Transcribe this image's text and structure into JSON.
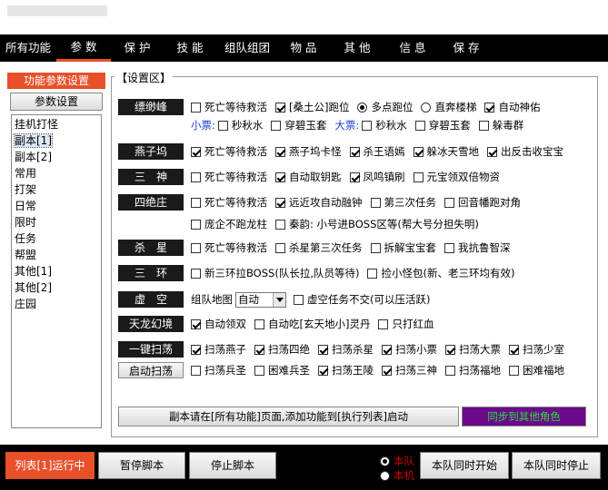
{
  "menu": {
    "tabs": [
      "所有功能",
      "参 数",
      "保 护",
      "技 能",
      "组队组团",
      "物 品",
      "其 他",
      "信 息",
      "保 存"
    ],
    "active_index": 1
  },
  "left": {
    "header": "功能参数设置",
    "param_button": "参数设置",
    "items": [
      "挂机打怪",
      "副本[1]",
      "副本[2]",
      "常用",
      "打架",
      "日常",
      "限时",
      "任务",
      "帮盟",
      "其他[1]",
      "其他[2]",
      "庄园"
    ],
    "selected_index": 1
  },
  "settings": {
    "legend": "【设置区】",
    "rows": [
      {
        "label": "缥缈峰",
        "opts": [
          {
            "t": "死亡等待救活",
            "on": false
          },
          {
            "t": "[桑土公]跑位",
            "on": true
          },
          {
            "t": "多点跑位",
            "on": true,
            "radio": true
          },
          {
            "t": "直奔楼梯",
            "on": false,
            "radio": true
          },
          {
            "t": "自动神佑",
            "on": true
          }
        ]
      },
      {
        "label": "",
        "sub": true,
        "opts": [
          {
            "pre": "小票:",
            "t": "秒秋水",
            "on": false
          },
          {
            "t": "穿碧玉套",
            "on": false
          },
          {
            "pre": "大票:",
            "t": "秒秋水",
            "on": false
          },
          {
            "t": "穿碧玉套",
            "on": false
          },
          {
            "t": "躲毒群",
            "on": false
          }
        ]
      },
      {
        "label": "燕子坞",
        "opts": [
          {
            "t": "死亡等待救活",
            "on": true
          },
          {
            "t": "燕子坞卡怪",
            "on": true
          },
          {
            "t": "杀王语嫣",
            "on": true
          },
          {
            "t": "躲冰天雪地",
            "on": true
          },
          {
            "t": "出反击收宝宝",
            "on": true
          }
        ]
      },
      {
        "label": "三　神",
        "opts": [
          {
            "t": "死亡等待救活",
            "on": false
          },
          {
            "t": "自动取钥匙",
            "on": true
          },
          {
            "t": "凤鸣镇刷",
            "on": true
          },
          {
            "t": "元宝领双倍物资",
            "on": false
          }
        ]
      },
      {
        "label": "四绝庄",
        "opts": [
          {
            "t": "死亡等待救活",
            "on": false
          },
          {
            "t": "远近攻自动融钟",
            "on": true
          },
          {
            "t": "第三次任务",
            "on": false
          },
          {
            "t": "回音幡跑对角",
            "on": false
          }
        ]
      },
      {
        "label": "",
        "sub": true,
        "opts": [
          {
            "t": "庞企不跑龙柱",
            "on": false
          },
          {
            "t": "秦韵: 小号进BOSS区等(帮大号分担失明)",
            "on": false
          }
        ]
      },
      {
        "label": "杀　星",
        "opts": [
          {
            "t": "死亡等待救活",
            "on": false
          },
          {
            "t": "杀星第三次任务",
            "on": false
          },
          {
            "t": "拆解宝宝套",
            "on": false
          },
          {
            "t": "我抗鲁智深",
            "on": false
          }
        ]
      },
      {
        "label": "三　环",
        "opts": [
          {
            "t": "新三环拉BOSS(队长拉,队员等待)",
            "on": false
          },
          {
            "t": "捡小怪包(新、老三环均有效)",
            "on": false
          }
        ]
      },
      {
        "label": "虚　空",
        "opts": [
          {
            "pre": "组队地图",
            "select": "自动"
          },
          {
            "t": "虚空任务不交(可以压活跃)",
            "on": false
          }
        ]
      },
      {
        "label": "天龙幻境",
        "opts": [
          {
            "t": "自动领双",
            "on": true
          },
          {
            "t": "自动吃[玄天地小]灵丹",
            "on": false
          },
          {
            "t": "只打红血",
            "on": false
          }
        ]
      },
      {
        "label": "一键扫荡",
        "opts": [
          {
            "t": "扫荡燕子",
            "on": true
          },
          {
            "t": "扫荡四绝",
            "on": true
          },
          {
            "t": "扫荡杀星",
            "on": true
          },
          {
            "t": "扫荡小票",
            "on": true
          },
          {
            "t": "扫荡大票",
            "on": true
          },
          {
            "t": "扫荡少室",
            "on": true
          }
        ]
      },
      {
        "label": "启动扫荡",
        "button": true,
        "opts": [
          {
            "t": "扫荡兵圣",
            "on": false
          },
          {
            "t": "困难兵圣",
            "on": false
          },
          {
            "t": "扫荡王陵",
            "on": true
          },
          {
            "t": "扫荡三神",
            "on": true
          },
          {
            "t": "扫荡福地",
            "on": false
          },
          {
            "t": "困难福地",
            "on": false
          }
        ]
      }
    ],
    "notice": "副本请在[所有功能]页面,添加功能到[执行列表]启动",
    "sync_button": "同步到其他角色"
  },
  "bottom": {
    "run_status": "列表[1]运行中",
    "pause": "暂停脚本",
    "stop": "停止脚本",
    "radio_team": "本队",
    "radio_machine": "本机",
    "team_start": "本队同时开始",
    "team_stop": "本队同时停止"
  },
  "colors": {
    "accent": "#e8502a",
    "sync_bg": "#6a0a8a",
    "sync_text": "#28e03a",
    "blue_label": "#1a3fd6"
  }
}
